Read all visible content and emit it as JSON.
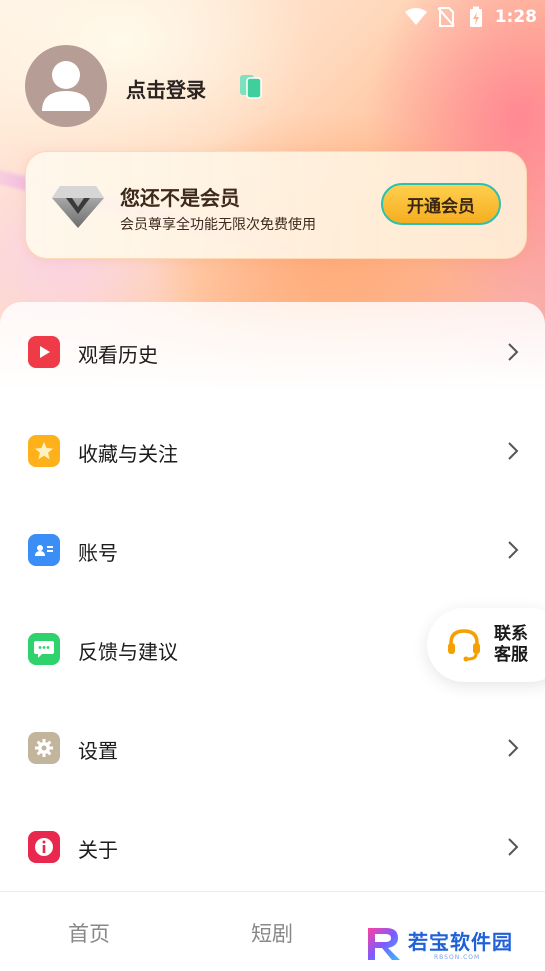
{
  "status_bar": {
    "time": "1:28",
    "icons": [
      "wifi-icon",
      "no-sim-icon",
      "battery-charging-icon"
    ]
  },
  "profile": {
    "login_label": "点击登录",
    "avatar_icon": "avatar-placeholder-icon",
    "switch_icon": "copy-icon"
  },
  "vip": {
    "title": "您还不是会员",
    "subtitle": "会员尊享全功能无限次免费使用",
    "button_label": "开通会员",
    "icon": "diamond-v-icon",
    "button_color": "#f7b52a",
    "button_border": "#2bc0b0"
  },
  "menu": {
    "items": [
      {
        "label": "观看历史",
        "icon": "play-icon",
        "color": "#ee3b47"
      },
      {
        "label": "收藏与关注",
        "icon": "star-icon",
        "color": "#ffb11c"
      },
      {
        "label": "账号",
        "icon": "id-card-icon",
        "color": "#3b8ef5"
      },
      {
        "label": "反馈与建议",
        "icon": "chat-bubble-icon",
        "color": "#2fd26d"
      },
      {
        "label": "设置",
        "icon": "gear-icon",
        "color": "#c3b49c"
      },
      {
        "label": "关于",
        "icon": "info-icon",
        "color": "#e8284f"
      }
    ]
  },
  "service": {
    "label_line1": "联系",
    "label_line2": "客服",
    "icon": "headset-icon",
    "icon_color": "#f5a000"
  },
  "tabs": [
    {
      "label": "首页"
    },
    {
      "label": "短剧"
    }
  ],
  "watermark": {
    "main": "若宝软件园",
    "sub": "RBSON.COM"
  }
}
